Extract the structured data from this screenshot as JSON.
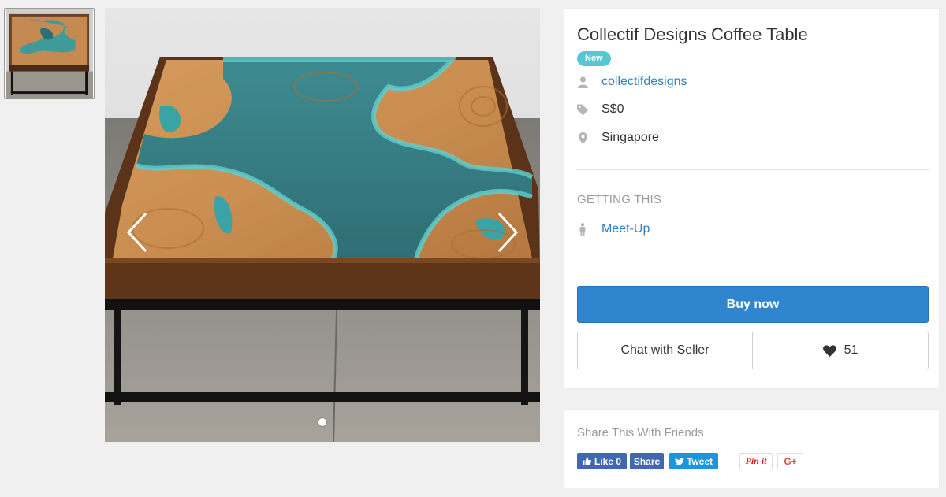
{
  "listing": {
    "title": "Collectif Designs Coffee Table",
    "condition_badge": "New",
    "seller": "collectifdesigns",
    "price": "S$0",
    "location": "Singapore"
  },
  "icons": {
    "seller": "user-icon",
    "price": "price-tag-icon",
    "location": "map-pin-icon",
    "meetup": "person-icon",
    "like": "heart-icon",
    "prev": "chevron-left-icon",
    "next": "chevron-right-icon"
  },
  "getting": {
    "section_label": "GETTING THIS",
    "method": "Meet-Up"
  },
  "actions": {
    "buy_label": "Buy now",
    "chat_label": "Chat with Seller",
    "like_count": "51"
  },
  "gallery": {
    "image_count": 1,
    "active_index": 0
  },
  "share": {
    "title": "Share This With Friends",
    "fb_like": "Like 0",
    "fb_share": "Share",
    "tweet": "Tweet",
    "pinterest": "Pin it",
    "gplus": "G+"
  },
  "colors": {
    "accent_blue": "#2f86ce",
    "link_blue": "#2f80c4",
    "badge_teal": "#56c7d3",
    "facebook": "#4267b2",
    "twitter": "#1b95e0",
    "pinterest": "#cb2027",
    "gplus": "#dd4b39"
  }
}
